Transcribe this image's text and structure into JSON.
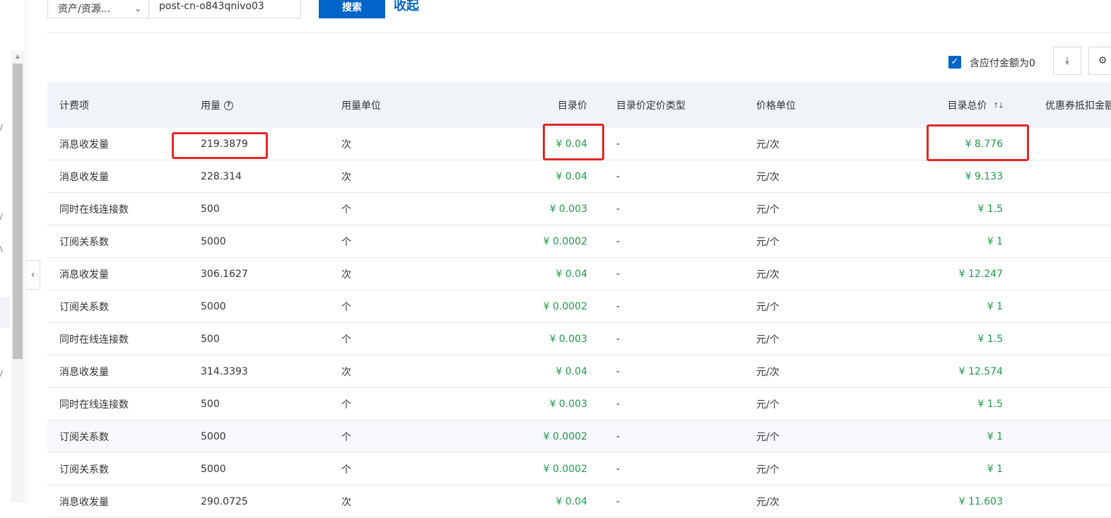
{
  "search": {
    "scope_label": "资产/资源...",
    "query_value": "post-cn-o843qnivo03",
    "search_label": "搜索",
    "collapse_label": "收起"
  },
  "toolbar": {
    "include_zero_label": "含应付金额为0",
    "include_zero_checked": true,
    "icons": [
      "download-icon",
      "settings-icon"
    ]
  },
  "table": {
    "columns": {
      "item": "计费项",
      "usage": "用量",
      "usage_unit": "用量单位",
      "list_price": "目录价",
      "pricing_type": "目录价定价类型",
      "price_unit": "价格单位",
      "list_total": "目录总价",
      "coupon": "优惠券抵扣金额"
    },
    "rows": [
      {
        "item": "消息收发量",
        "usage": "219.3879",
        "usage_unit": "次",
        "list_price": "¥ 0.04",
        "pricing_type": "-",
        "price_unit": "元/次",
        "list_total": "¥ 8.776"
      },
      {
        "item": "消息收发量",
        "usage": "228.314",
        "usage_unit": "次",
        "list_price": "¥ 0.04",
        "pricing_type": "-",
        "price_unit": "元/次",
        "list_total": "¥ 9.133"
      },
      {
        "item": "同时在线连接数",
        "usage": "500",
        "usage_unit": "个",
        "list_price": "¥ 0.003",
        "pricing_type": "-",
        "price_unit": "元/个",
        "list_total": "¥ 1.5"
      },
      {
        "item": "订阅关系数",
        "usage": "5000",
        "usage_unit": "个",
        "list_price": "¥ 0.0002",
        "pricing_type": "-",
        "price_unit": "元/个",
        "list_total": "¥ 1"
      },
      {
        "item": "消息收发量",
        "usage": "306.1627",
        "usage_unit": "次",
        "list_price": "¥ 0.04",
        "pricing_type": "-",
        "price_unit": "元/次",
        "list_total": "¥ 12.247"
      },
      {
        "item": "订阅关系数",
        "usage": "5000",
        "usage_unit": "个",
        "list_price": "¥ 0.0002",
        "pricing_type": "-",
        "price_unit": "元/个",
        "list_total": "¥ 1"
      },
      {
        "item": "同时在线连接数",
        "usage": "500",
        "usage_unit": "个",
        "list_price": "¥ 0.003",
        "pricing_type": "-",
        "price_unit": "元/个",
        "list_total": "¥ 1.5"
      },
      {
        "item": "消息收发量",
        "usage": "314.3393",
        "usage_unit": "次",
        "list_price": "¥ 0.04",
        "pricing_type": "-",
        "price_unit": "元/次",
        "list_total": "¥ 12.574"
      },
      {
        "item": "同时在线连接数",
        "usage": "500",
        "usage_unit": "个",
        "list_price": "¥ 0.003",
        "pricing_type": "-",
        "price_unit": "元/个",
        "list_total": "¥ 1.5"
      },
      {
        "item": "订阅关系数",
        "usage": "5000",
        "usage_unit": "个",
        "list_price": "¥ 0.0002",
        "pricing_type": "-",
        "price_unit": "元/个",
        "list_total": "¥ 1"
      },
      {
        "item": "订阅关系数",
        "usage": "5000",
        "usage_unit": "个",
        "list_price": "¥ 0.0002",
        "pricing_type": "-",
        "price_unit": "元/个",
        "list_total": "¥ 1"
      },
      {
        "item": "消息收发量",
        "usage": "290.0725",
        "usage_unit": "次",
        "list_price": "¥ 0.04",
        "pricing_type": "-",
        "price_unit": "元/次",
        "list_total": "¥ 11.603"
      }
    ]
  },
  "colors": {
    "primary": "#0064c8",
    "price_green": "#1e9a4b",
    "highlight_red": "#e32727",
    "header_bg": "#f0f3f8"
  }
}
